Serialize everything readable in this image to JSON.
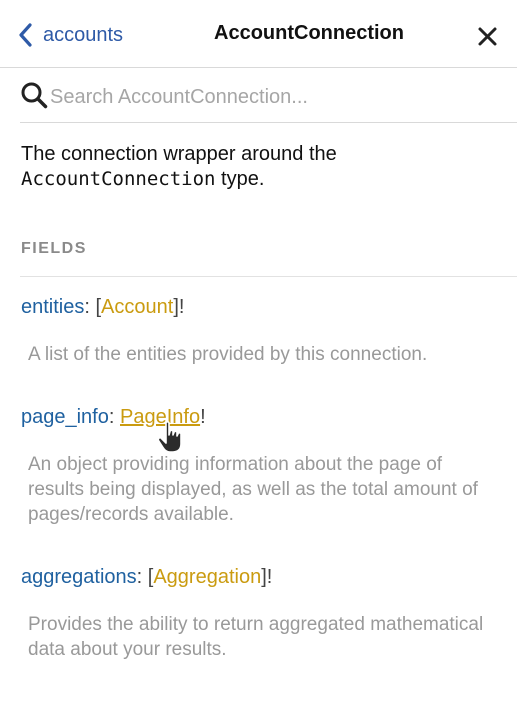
{
  "header": {
    "back_label": "accounts",
    "title": "AccountConnection"
  },
  "search": {
    "placeholder": "Search AccountConnection..."
  },
  "description": {
    "prefix": "The connection wrapper around the",
    "type_name": "AccountConnection",
    "suffix": " type."
  },
  "fields_heading": "FIELDS",
  "fields": [
    {
      "name": "entities",
      "sep": ": [",
      "type": "Account",
      "suffix": "]!",
      "description": "A list of the entities provided by this connection."
    },
    {
      "name": "page_info",
      "sep": ": ",
      "type": "PageInfo",
      "suffix": "!",
      "description": "An object providing information about the page of results being displayed, as well as the total amount of pages/records available."
    },
    {
      "name": "aggregations",
      "sep": ": [",
      "type": "Aggregation",
      "suffix": "]!",
      "description": "Provides the ability to return aggregated mathematical data about your results."
    }
  ],
  "icons": {
    "back": "chevron-left-icon",
    "close": "close-icon",
    "search": "search-icon",
    "cursor": "hand-pointer-icon"
  },
  "colors": {
    "field_name": "#1f61a0",
    "type_link": "#ca9b10",
    "muted_text": "#999999"
  }
}
